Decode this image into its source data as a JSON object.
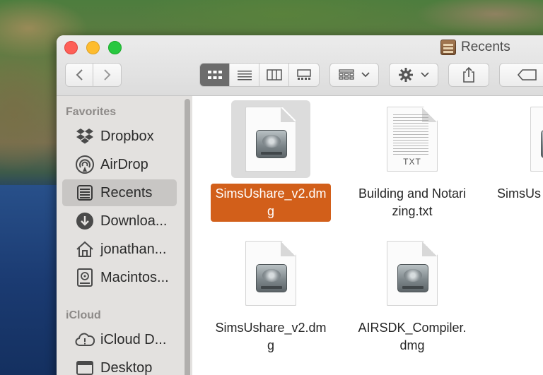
{
  "window": {
    "title": "Recents"
  },
  "sidebar": {
    "sections": [
      {
        "label": "Favorites",
        "items": [
          {
            "label": "Dropbox",
            "icon": "dropbox-icon"
          },
          {
            "label": "AirDrop",
            "icon": "airdrop-icon"
          },
          {
            "label": "Recents",
            "icon": "recents-icon",
            "active": true
          },
          {
            "label": "Downloa...",
            "icon": "downloads-icon"
          },
          {
            "label": "jonathan...",
            "icon": "home-icon"
          },
          {
            "label": "Macintos...",
            "icon": "hard-drive-icon"
          }
        ]
      },
      {
        "label": "iCloud",
        "items": [
          {
            "label": "iCloud D...",
            "icon": "icloud-icon"
          },
          {
            "label": "Desktop",
            "icon": "desktop-icon"
          }
        ]
      }
    ]
  },
  "files": [
    {
      "name": "SimsUshare_v2.dmg",
      "type": "dmg",
      "selected": true
    },
    {
      "name": "Building and Notarizing.txt",
      "type": "txt",
      "tag": "TXT"
    },
    {
      "name": "SimsUs",
      "type": "dmg"
    },
    {
      "name": "SimsUshare_v2.dmg",
      "type": "dmg"
    },
    {
      "name": "AIRSDK_Compiler.dmg",
      "type": "dmg"
    }
  ],
  "colors": {
    "selection": "#d25f1a",
    "close": "#fe5f57",
    "minimize": "#febc2e",
    "zoom": "#28c840"
  }
}
